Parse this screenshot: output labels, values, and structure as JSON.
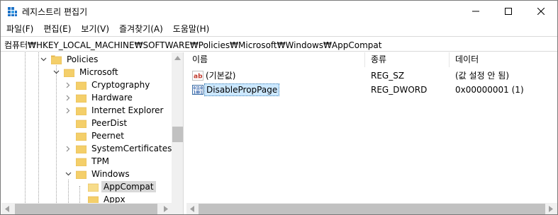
{
  "window": {
    "title": "레지스트리 편집기"
  },
  "menu": [
    "파일(F)",
    "편집(E)",
    "보기(V)",
    "즐겨찾기(A)",
    "도움말(H)"
  ],
  "address": {
    "path": "컴퓨터₩HKEY_LOCAL_MACHINE₩SOFTWARE₩Policies₩Microsoft₩Windows₩AppCompat"
  },
  "tree": {
    "items": [
      {
        "label": "Policies",
        "expanded": true
      },
      {
        "label": "Microsoft",
        "expanded": true
      },
      {
        "label": "Cryptography",
        "expanded": false
      },
      {
        "label": "Hardware",
        "expanded": false
      },
      {
        "label": "Internet Explorer",
        "expanded": false
      },
      {
        "label": "PeerDist",
        "expanded": false
      },
      {
        "label": "Peernet",
        "expanded": false
      },
      {
        "label": "SystemCertificates",
        "expanded": false
      },
      {
        "label": "TPM",
        "expanded": false
      },
      {
        "label": "Windows",
        "expanded": true
      },
      {
        "label": "AppCompat",
        "selected": true
      },
      {
        "label": "Appx"
      }
    ]
  },
  "list": {
    "columns": [
      "이름",
      "종류",
      "데이터"
    ],
    "rows": [
      {
        "name": "(기본값)",
        "type": "REG_SZ",
        "data": "(값 설정 안 됨)",
        "icon": "string-value-icon"
      },
      {
        "name": "DisablePropPage",
        "type": "REG_DWORD",
        "data": "0x00000001 (1)",
        "icon": "binary-value-icon",
        "selected": true
      }
    ]
  },
  "colors": {
    "folder": "#f4cf6a",
    "selection": "#cce8ff",
    "tree_selection": "#d9d9d9"
  }
}
